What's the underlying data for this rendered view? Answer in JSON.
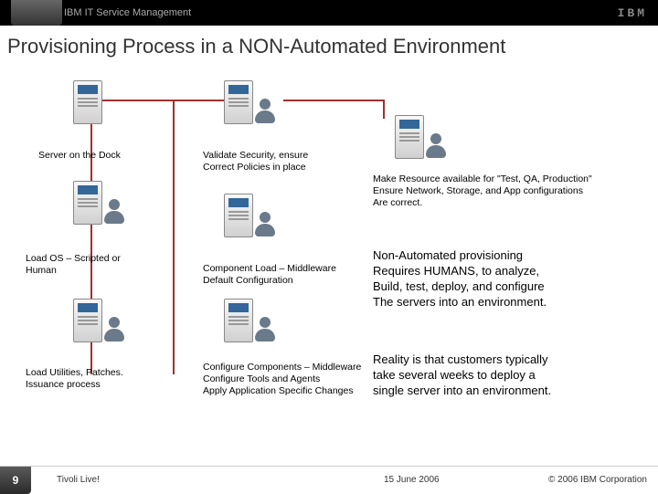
{
  "header": {
    "title": "IBM IT Service Management",
    "logo": "IBM"
  },
  "title": "Provisioning Process in a NON-Automated Environment",
  "steps": {
    "s1": "Server on the Dock",
    "s2": "Load OS – Scripted or\nHuman",
    "s3": "Load Utilities, Patches.\nIssuance process",
    "s4": "Validate Security, ensure\nCorrect Policies in place",
    "s5": "Component Load – Middleware\nDefault Configuration",
    "s6": "Configure Components – Middleware\nConfigure Tools and Agents\nApply Application Specific Changes",
    "s7": "Make Resource available for \"Test, QA, Production\"\nEnsure Network, Storage, and App configurations\nAre correct."
  },
  "body": {
    "p1": "Non-Automated provisioning\nRequires HUMANS, to analyze,\nBuild, test, deploy, and configure\nThe servers into an environment.",
    "p2": "Reality is that customers typically\ntake several weeks to deploy a\nsingle server into an environment."
  },
  "footer": {
    "page": "9",
    "event": "Tivoli Live!",
    "date": "15 June 2006",
    "copyright": "© 2006 IBM Corporation"
  }
}
